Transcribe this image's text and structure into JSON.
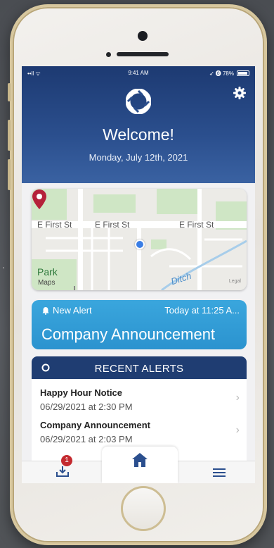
{
  "status_bar": {
    "signal": "••ll ᯤ",
    "time": "9:41 AM",
    "battery": "➶ ⓿ 78%"
  },
  "header": {
    "welcome": "Welcome!",
    "date": "Monday, July 12th, 2021"
  },
  "map": {
    "street_labels": [
      "E First St",
      "E First St",
      "E First St"
    ],
    "park_label": "Park",
    "attribution": "Maps",
    "water_label": "Ditch",
    "legal": "Legal"
  },
  "new_alert": {
    "tag": "New Alert",
    "time": "Today at 11:25 A...",
    "title": "Company Announcement"
  },
  "recent_alerts": {
    "title": "RECENT ALERTS",
    "items": [
      {
        "title": "Happy Hour Notice",
        "date": "06/29/2021 at 2:30 PM"
      },
      {
        "title": "Company Announcement",
        "date": "06/29/2021 at 2:03 PM"
      }
    ]
  },
  "tabbar": {
    "badge_count": "1"
  },
  "colors": {
    "header": "#2b4f8e",
    "alert": "#2f9bd6",
    "badge": "#c42a2f",
    "recent_header": "#1f3d72"
  }
}
